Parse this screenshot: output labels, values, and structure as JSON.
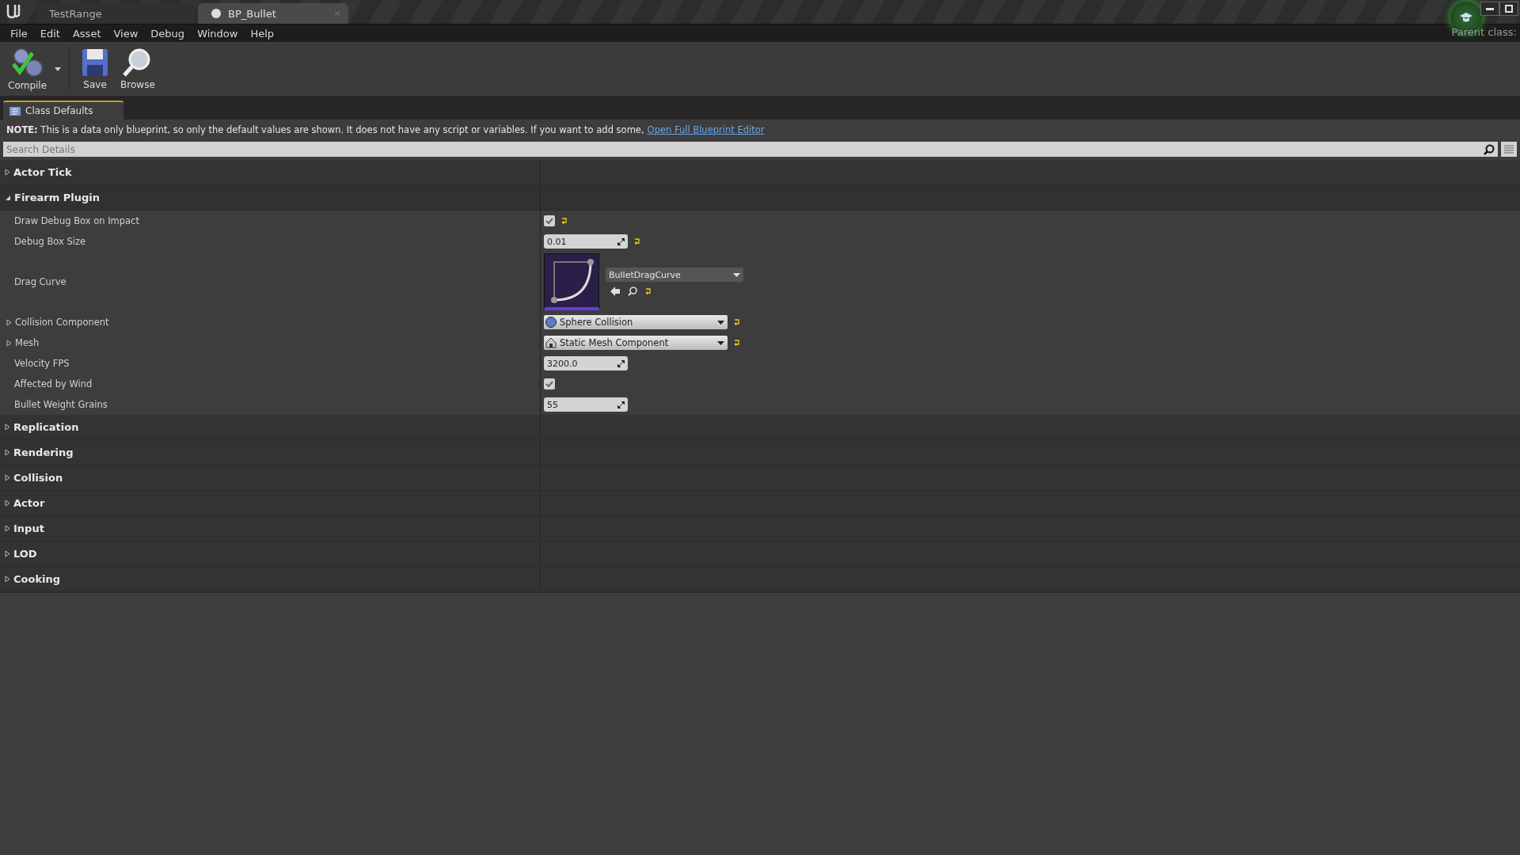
{
  "document_tabs": [
    {
      "label": "TestRange",
      "selected": false,
      "kind": "level"
    },
    {
      "label": "BP_Bullet",
      "selected": true,
      "kind": "blueprint"
    }
  ],
  "parent_class": {
    "label": "Parent class:"
  },
  "menu": [
    "File",
    "Edit",
    "Asset",
    "View",
    "Debug",
    "Window",
    "Help"
  ],
  "toolbar": [
    {
      "label": "Compile",
      "kind": "compile",
      "has_dropdown": true
    },
    {
      "label": "Save",
      "kind": "save",
      "has_dropdown": false
    },
    {
      "label": "Browse",
      "kind": "browse",
      "has_dropdown": false
    }
  ],
  "panel_tab": {
    "label": "Class Defaults"
  },
  "note": {
    "text": "**NOTE:** This is a data only blueprint, so only the default values are shown.  It does not have any script or variables.  If you want to add some,",
    "link": "Open Full Blueprint Editor"
  },
  "search": {
    "placeholder": "Search Details"
  },
  "categories": [
    {
      "label": "Actor Tick",
      "expanded": false
    },
    {
      "label": "Firearm Plugin",
      "expanded": true,
      "properties": [
        {
          "label": "Draw Debug Box on Impact",
          "kind": "checkbox",
          "checked": true,
          "resettable": true,
          "expandable": false
        },
        {
          "label": "Debug Box Size",
          "kind": "number",
          "value": "0.01",
          "resettable": true,
          "expandable": false
        },
        {
          "label": "Drag Curve",
          "kind": "asset",
          "value": "BulletDragCurve",
          "resettable": true,
          "expandable": false
        },
        {
          "label": "Collision Component",
          "kind": "sphere_combo",
          "value": "Sphere Collision",
          "resettable": true,
          "expandable": true
        },
        {
          "label": "Mesh",
          "kind": "mesh_combo",
          "value": "Static Mesh Component",
          "resettable": true,
          "expandable": true
        },
        {
          "label": "Velocity FPS",
          "kind": "number",
          "value": "3200.0",
          "resettable": false,
          "expandable": false
        },
        {
          "label": "Affected by Wind",
          "kind": "checkbox",
          "checked": true,
          "resettable": false,
          "expandable": false
        },
        {
          "label": "Bullet Weight Grains",
          "kind": "number",
          "value": "55",
          "resettable": false,
          "expandable": false
        }
      ]
    },
    {
      "label": "Replication",
      "expanded": false
    },
    {
      "label": "Rendering",
      "expanded": false
    },
    {
      "label": "Collision",
      "expanded": false
    },
    {
      "label": "Actor",
      "expanded": false
    },
    {
      "label": "Input",
      "expanded": false
    },
    {
      "label": "LOD",
      "expanded": false
    },
    {
      "label": "Cooking",
      "expanded": false
    }
  ]
}
